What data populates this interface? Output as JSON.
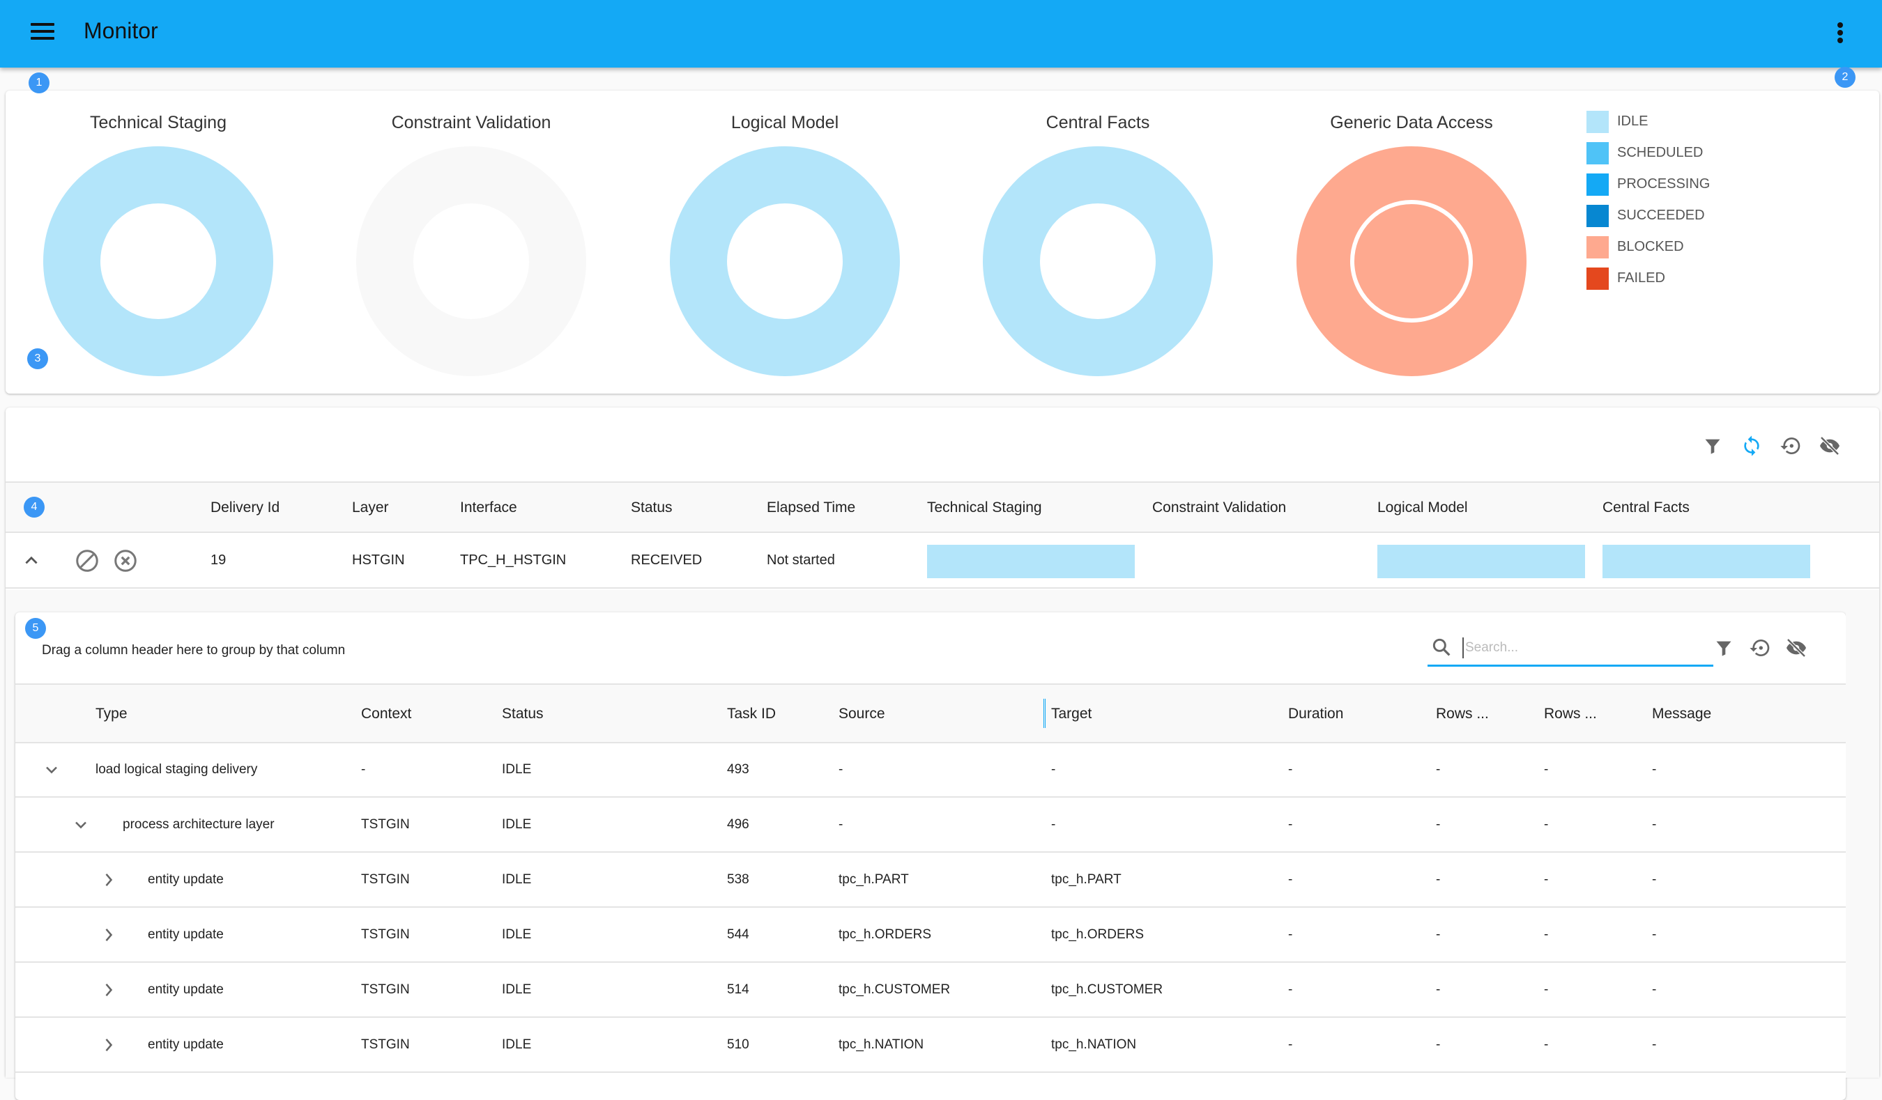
{
  "appbar": {
    "title": "Monitor",
    "menu_icon": "hamburger-menu-icon",
    "more_icon": "more-vertical-icon"
  },
  "badges": [
    "1",
    "2",
    "3",
    "4",
    "5"
  ],
  "chart_data": {
    "type": "pie",
    "variant": "donut",
    "title": "",
    "legend_position": "right",
    "legend": [
      {
        "label": "IDLE",
        "color": "#b3e5fa"
      },
      {
        "label": "SCHEDULED",
        "color": "#4fc3f7"
      },
      {
        "label": "PROCESSING",
        "color": "#14a9f5"
      },
      {
        "label": "SUCCEEDED",
        "color": "#0787d1"
      },
      {
        "label": "BLOCKED",
        "color": "#fea98f"
      },
      {
        "label": "FAILED",
        "color": "#e4481e"
      }
    ],
    "donuts": [
      {
        "title": "Technical Staging",
        "slices": [
          {
            "status": "IDLE",
            "value": 1
          }
        ],
        "color": "#b3e5fa",
        "empty": false
      },
      {
        "title": "Constraint Validation",
        "slices": [],
        "color": "#f8f8f8",
        "empty": true
      },
      {
        "title": "Logical Model",
        "slices": [
          {
            "status": "IDLE",
            "value": 1
          }
        ],
        "color": "#b3e5fa",
        "empty": false
      },
      {
        "title": "Central Facts",
        "slices": [
          {
            "status": "IDLE",
            "value": 1
          }
        ],
        "color": "#b3e5fa",
        "empty": false
      },
      {
        "title": "Generic Data Access",
        "slices": [
          {
            "status": "BLOCKED",
            "value": 1
          }
        ],
        "inner_ring": {
          "status": "BLOCKED",
          "value": 1
        },
        "color": "#fea98f",
        "empty": false
      }
    ]
  },
  "deliveries": {
    "toolbar": [
      "filter-icon",
      "refresh-icon",
      "restore-icon",
      "hide-columns-icon"
    ],
    "columns": [
      "Delivery Id",
      "Layer",
      "Interface",
      "Status",
      "Elapsed Time",
      "Technical Staging",
      "Constraint Validation",
      "Logical Model",
      "Central Facts"
    ],
    "rows": [
      {
        "delivery_id": "19",
        "layer": "HSTGIN",
        "interface": "TPC_H_HSTGIN",
        "status": "RECEIVED",
        "elapsed": "Not started",
        "stages": [
          {
            "stage": "Technical Staging",
            "status": "IDLE",
            "progress": 1
          },
          {
            "stage": "Constraint Validation",
            "status": "",
            "progress": 0
          },
          {
            "stage": "Logical Model",
            "status": "IDLE",
            "progress": 1
          },
          {
            "stage": "Central Facts",
            "status": "IDLE",
            "progress": 1
          }
        ]
      }
    ]
  },
  "tasks": {
    "group_hint": "Drag a column header here to group by that column",
    "search_placeholder": "Search...",
    "search_value": "",
    "columns": [
      "Type",
      "Context",
      "Status",
      "Task ID",
      "Source",
      "Target",
      "Duration",
      "Rows ...",
      "Rows ...",
      "Message"
    ],
    "rows": [
      {
        "expand": "expanded",
        "level": 0,
        "type": "load logical staging delivery",
        "context": "-",
        "status": "IDLE",
        "task_id": "493",
        "source": "-",
        "target": "-",
        "duration": "-",
        "rows_a": "-",
        "rows_b": "-",
        "message": "-"
      },
      {
        "expand": "expanded",
        "level": 1,
        "type": "process architecture layer",
        "context": "TSTGIN",
        "status": "IDLE",
        "task_id": "496",
        "source": "-",
        "target": "-",
        "duration": "-",
        "rows_a": "-",
        "rows_b": "-",
        "message": "-"
      },
      {
        "expand": "collapsed",
        "level": 2,
        "type": "entity update",
        "context": "TSTGIN",
        "status": "IDLE",
        "task_id": "538",
        "source": "tpc_h.PART",
        "target": "tpc_h.PART",
        "duration": "-",
        "rows_a": "-",
        "rows_b": "-",
        "message": "-"
      },
      {
        "expand": "collapsed",
        "level": 2,
        "type": "entity update",
        "context": "TSTGIN",
        "status": "IDLE",
        "task_id": "544",
        "source": "tpc_h.ORDERS",
        "target": "tpc_h.ORDERS",
        "duration": "-",
        "rows_a": "-",
        "rows_b": "-",
        "message": "-"
      },
      {
        "expand": "collapsed",
        "level": 2,
        "type": "entity update",
        "context": "TSTGIN",
        "status": "IDLE",
        "task_id": "514",
        "source": "tpc_h.CUSTOMER",
        "target": "tpc_h.CUSTOMER",
        "duration": "-",
        "rows_a": "-",
        "rows_b": "-",
        "message": "-"
      },
      {
        "expand": "collapsed",
        "level": 2,
        "type": "entity update",
        "context": "TSTGIN",
        "status": "IDLE",
        "task_id": "510",
        "source": "tpc_h.NATION",
        "target": "tpc_h.NATION",
        "duration": "-",
        "rows_a": "-",
        "rows_b": "-",
        "message": "-"
      }
    ]
  }
}
